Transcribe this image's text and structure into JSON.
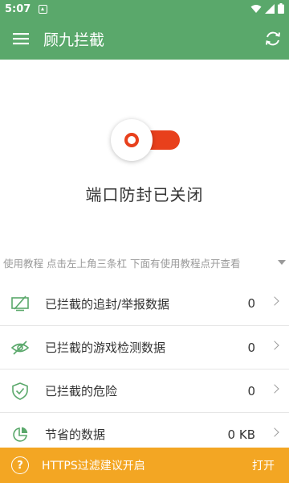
{
  "status_bar": {
    "time": "5:07",
    "left_icon": "notification-a-icon",
    "right_icons": [
      "wifi-icon",
      "signal-icon",
      "battery-icon"
    ]
  },
  "app_bar": {
    "title": "顾九拦截",
    "menu_icon": "menu-icon",
    "refresh_icon": "refresh-icon"
  },
  "protection": {
    "enabled": false,
    "status_text": "端口防封已关闭",
    "accent": "#e8401c"
  },
  "tip": {
    "text": "使用教程 点击左上角三条杠 下面有使用教程点开查看"
  },
  "stats": [
    {
      "icon": "screen-blocked-icon",
      "label": "已拦截的追封/举报数据",
      "value": "0"
    },
    {
      "icon": "eye-off-icon",
      "label": "已拦截的游戏检测数据",
      "value": "0"
    },
    {
      "icon": "shield-check-icon",
      "label": "已拦截的危险",
      "value": "0"
    },
    {
      "icon": "pie-chart-icon",
      "label": "节省的数据",
      "value": "0 KB"
    }
  ],
  "banner": {
    "icon": "question-icon",
    "icon_glyph": "?",
    "text": "HTTPS过滤建议开启",
    "action": "打开"
  },
  "colors": {
    "primary_green": "#5aa86b",
    "banner_orange": "#f3a623",
    "toggle_red": "#e8401c"
  }
}
